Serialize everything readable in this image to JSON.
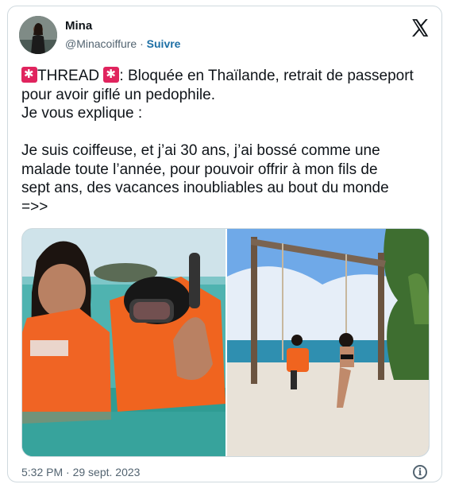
{
  "author": {
    "name": "Mina",
    "handle": "@Minacoiffure",
    "separator": "·",
    "follow_label": "Suivre"
  },
  "tweet": {
    "thread_label": "THREAD",
    "line1_rest": ": Bloquée en Thaïlande, retrait de passeport",
    "line2": "pour avoir giflé un pedophile.",
    "line3": "Je vous explique :",
    "line4": "",
    "line5": "Je suis coiffeuse, et j’ai 30 ans, j’ai bossé comme une",
    "line6": "malade toute l’année, pour pouvoir offrir à mon fils de",
    "line7": "sept ans, des vacances inoubliables au bout du monde",
    "line8": "=>>"
  },
  "icons": {
    "x_logo": "x-logo-icon",
    "siren": "police-car-light-emoji",
    "info": "info-icon"
  },
  "footer": {
    "timestamp": "5:32 PM · 29 sept. 2023"
  }
}
